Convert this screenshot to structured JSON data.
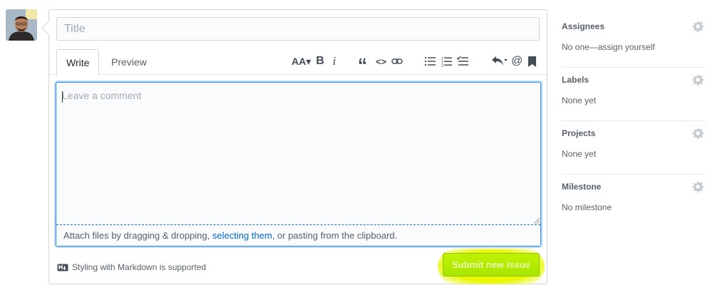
{
  "issue_form": {
    "title_placeholder": "Title",
    "tabs": [
      {
        "label": "Write",
        "selected": true
      },
      {
        "label": "Preview",
        "selected": false
      }
    ],
    "toolbar": [
      {
        "name": "header-text",
        "glyph": "AA▾"
      },
      {
        "name": "bold",
        "glyph": "B"
      },
      {
        "name": "italic",
        "glyph": "i"
      },
      {
        "name": "quote",
        "glyph": "“"
      },
      {
        "name": "code",
        "glyph": "<>"
      },
      {
        "name": "link",
        "icon": "link-icon"
      },
      {
        "name": "bulleted-list",
        "icon": "list-unordered-icon"
      },
      {
        "name": "numbered-list",
        "icon": "list-ordered-icon"
      },
      {
        "name": "task-list",
        "icon": "tasklist-icon"
      },
      {
        "name": "reply",
        "icon": "reply-icon"
      },
      {
        "name": "mention",
        "glyph": "@"
      },
      {
        "name": "saved-reply",
        "icon": "bookmark-icon"
      }
    ],
    "comment_placeholder": "Leave a comment",
    "attach": {
      "prefix": "Attach files by dragging & dropping, ",
      "link": "selecting them",
      "suffix": ", or pasting from the clipboard."
    },
    "markdown_note": "Styling with Markdown is supported",
    "submit_label": "Submit new issue"
  },
  "sidebar": {
    "sections": [
      {
        "heading": "Assignees",
        "value": "No one—assign yourself"
      },
      {
        "heading": "Labels",
        "value": "None yet"
      },
      {
        "heading": "Projects",
        "value": "None yet"
      },
      {
        "heading": "Milestone",
        "value": "No milestone"
      }
    ]
  },
  "colors": {
    "accent_blue": "#0366d6",
    "highlight_yellow": "#f4ff00",
    "submit_green": "#a8e500"
  }
}
